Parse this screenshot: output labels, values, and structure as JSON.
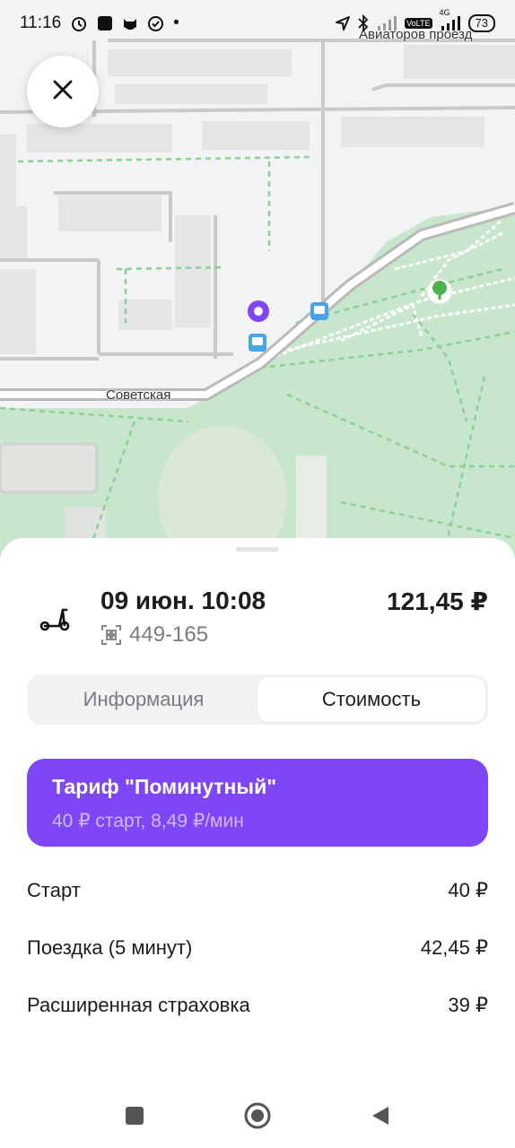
{
  "status_bar": {
    "time": "11:16",
    "dot": "•",
    "network": "4G",
    "volte": "VoLTE",
    "battery": "73",
    "icons": [
      "alarm-icon",
      "app-square-icon",
      "cat-icon",
      "check-circle-icon",
      "location-arrow-icon",
      "bluetooth-icon",
      "signal-icon",
      "signal-icon"
    ]
  },
  "map": {
    "streets": {
      "aviatorov": "Авиаторов проезд",
      "sovetskaya": "Советская"
    },
    "markers": [
      "location-pin-icon",
      "bus-stop-icon",
      "bus-stop-icon",
      "park-tree-icon"
    ]
  },
  "close_button": {
    "icon": "close-icon"
  },
  "ride": {
    "date": "09 июн. 10:08",
    "scooter_id": "449-165",
    "total": "121,45 ₽",
    "icons": [
      "scooter-icon",
      "qr-icon"
    ]
  },
  "tabs": [
    {
      "label": "Информация",
      "active": false
    },
    {
      "label": "Стоимость",
      "active": true
    }
  ],
  "tariff": {
    "title": "Тариф \"Поминутный\"",
    "subtitle": "40 ₽ старт, 8,49 ₽/мин",
    "color": "#7f46f6"
  },
  "costs": [
    {
      "label": "Старт",
      "value": "40 ₽"
    },
    {
      "label": "Поездка (5 минут)",
      "value": "42,45 ₽"
    },
    {
      "label": "Расширенная страховка",
      "value": "39 ₽"
    }
  ],
  "colors": {
    "accent": "#7f46f6",
    "park": "#c8e6cc",
    "road": "#b9b9b9"
  },
  "nav": [
    "recents-square-icon",
    "home-circle-icon",
    "back-triangle-icon"
  ]
}
